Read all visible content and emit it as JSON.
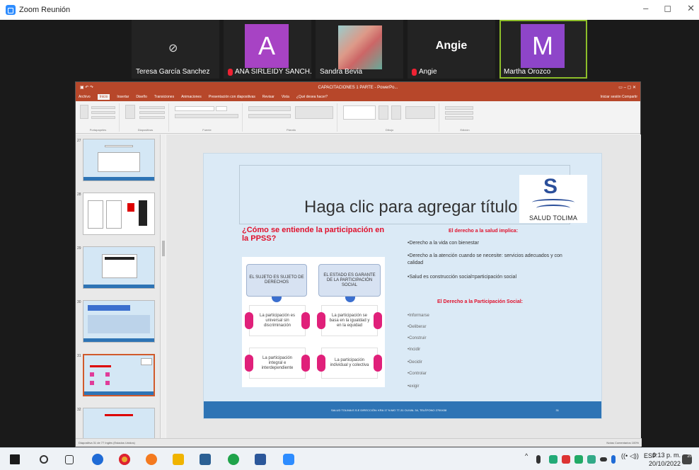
{
  "zoom": {
    "title": "Zoom Reunión",
    "controls": [
      "–",
      "◻",
      "✕"
    ]
  },
  "participants": [
    {
      "name": "Teresa García Sanchez",
      "muted": false,
      "type": "camera-off"
    },
    {
      "name": "ANA SIRLEIDY SANCH...",
      "muted": true,
      "type": "avatar",
      "letter": "A",
      "color": "#a743c4"
    },
    {
      "name": "Sandra Bevia",
      "muted": false,
      "type": "photo"
    },
    {
      "name": "Angie",
      "muted": true,
      "type": "name",
      "big_name": "Angie"
    },
    {
      "name": "Martha Orozco",
      "muted": false,
      "type": "avatar",
      "letter": "M",
      "color": "#8e45c9",
      "active": true
    }
  ],
  "ppt": {
    "window_title": "CAPACITACIONES 1 PARTE - PowerPo...",
    "tabs": [
      "Archivo",
      "Inicio",
      "Insertar",
      "Diseño",
      "Transiciones",
      "Animaciones",
      "Presentación con diapositivas",
      "Revisar",
      "Vista",
      "¿Qué desea hacer?"
    ],
    "tab_right": "Iniciar sesión   Compartir",
    "ribbon_groups": [
      "Portapapeles",
      "Diapositivas",
      "Fuente",
      "Párrafo",
      "Dibujo",
      "Edición"
    ],
    "thumb_numbers": [
      "27",
      "28",
      "29",
      "30",
      "31",
      "32"
    ],
    "status_left": "Diapositiva 31 de 77   Inglés (Estados Unidos)",
    "status_right": "Notas   Comentarios   100%"
  },
  "slide": {
    "title": "Haga clic para agregar título",
    "logo_text": "SALUD TOLIMA",
    "question": "¿Cómo se entiende la participación en la PPSS?",
    "diagram": {
      "left_header": "EL SUJETO ES SUJETO DE DERECHOS",
      "right_header": "EL ESTADO ES GARANTE DE LA PARTICIPACIÓN SOCIAL",
      "cards": [
        "La participación es universal sin discriminación",
        "La participación se basa en la igualdad y en la equidad",
        "La participación integral e interdependiente",
        "La participación individual y colectiva"
      ]
    },
    "heading1": "El derecho a la salud implica:",
    "bullets1": [
      "•Derecho a la vida con bienestar",
      "•Derecho a la atención cuando se necesite: servicios adecuados y con calidad",
      "•Salud es construcción social=participación social"
    ],
    "heading2": "El Derecho a la Participación Social:",
    "bullets2": [
      "•Informarse",
      "•Deliberar",
      "•Construir",
      "•Incidir",
      "•Decidir",
      "•Controlar",
      "•exigir"
    ],
    "footer_text": "SALUD TOLIMA E.S.E DIRECCIÓN: KRA 17 N.MO 77-31 OLIVAL 34, TELÉFONO 2700438",
    "page_number": "31"
  },
  "taskbar": {
    "language": "ESP",
    "time": "6:13 p. m.",
    "date": "20/10/2022",
    "notification_count": "20"
  }
}
